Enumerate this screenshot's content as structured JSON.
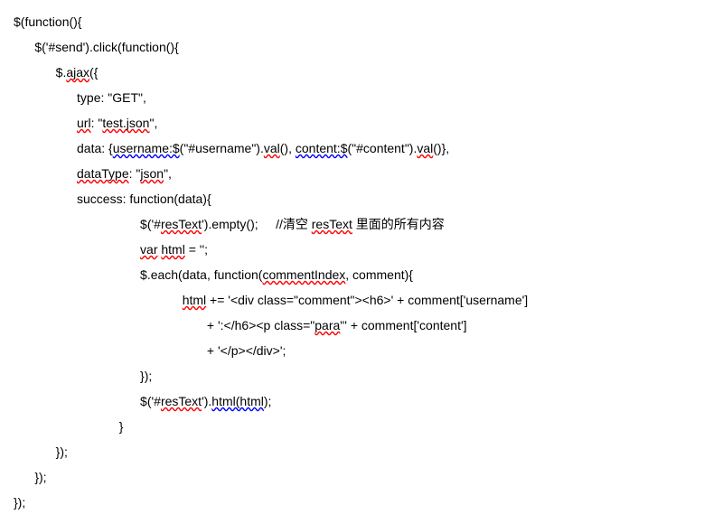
{
  "code": {
    "line1_a": "$(function(){",
    "line2_a": "      $('#send').click(function(){",
    "line3_a": "            $.",
    "line3_b": "ajax",
    "line3_c": "({",
    "line4_a": "                  type: \"GET\",",
    "line5_a": "                  ",
    "line5_b": "url",
    "line5_c": ": \"",
    "line5_d": "test.json",
    "line5_e": "\",",
    "line6_a": "                  data: {",
    "line6_b": "username:$",
    "line6_c": "(\"#username\").",
    "line6_d": "val",
    "line6_e": "(), ",
    "line6_f": "content:$",
    "line6_g": "(\"#content\").",
    "line6_h": "val",
    "line6_i": "()},",
    "line7_a": "                  ",
    "line7_b": "dataType",
    "line7_c": ": \"",
    "line7_d": "json",
    "line7_e": "\",",
    "line8_a": "                  success: function(data){",
    "line9_a": "                                    $('#",
    "line9_b": "resText",
    "line9_c": "').empty();     //清空 ",
    "line9_d": "resText",
    "line9_e": " 里面的所有内容",
    "line10_a": "                                    ",
    "line10_b": "var",
    "line10_c": " ",
    "line10_d": "html",
    "line10_e": " = '';",
    "line11_a": "                                    $.each(data, function(",
    "line11_b": "commentIndex",
    "line11_c": ", comment){",
    "line12_a": "                                                ",
    "line12_b": "html",
    "line12_c": " += '<div class=\"comment\"><h6>' + comment['username']",
    "line13_a": "                                                       + ':</h6><p class=\"",
    "line13_b": "para",
    "line13_c": "\"' + comment['content']",
    "line14_a": "                                                       + '</p></div>';",
    "line15_a": "                                    });",
    "line16_a": "                                    $('#",
    "line16_b": "resText",
    "line16_c": "').",
    "line16_d": "html(html",
    "line16_e": ");",
    "line17_a": "                              }",
    "line18_a": "            });",
    "line19_a": "      });",
    "line20_a": "});"
  }
}
